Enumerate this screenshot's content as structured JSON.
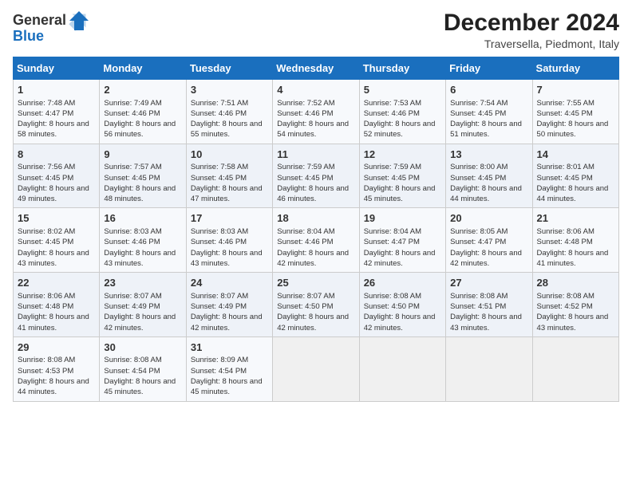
{
  "logo": {
    "line1": "General",
    "line2": "Blue"
  },
  "header": {
    "month": "December 2024",
    "location": "Traversella, Piedmont, Italy"
  },
  "weekdays": [
    "Sunday",
    "Monday",
    "Tuesday",
    "Wednesday",
    "Thursday",
    "Friday",
    "Saturday"
  ],
  "weeks": [
    [
      {
        "day": "1",
        "sunrise": "Sunrise: 7:48 AM",
        "sunset": "Sunset: 4:47 PM",
        "daylight": "Daylight: 8 hours and 58 minutes."
      },
      {
        "day": "2",
        "sunrise": "Sunrise: 7:49 AM",
        "sunset": "Sunset: 4:46 PM",
        "daylight": "Daylight: 8 hours and 56 minutes."
      },
      {
        "day": "3",
        "sunrise": "Sunrise: 7:51 AM",
        "sunset": "Sunset: 4:46 PM",
        "daylight": "Daylight: 8 hours and 55 minutes."
      },
      {
        "day": "4",
        "sunrise": "Sunrise: 7:52 AM",
        "sunset": "Sunset: 4:46 PM",
        "daylight": "Daylight: 8 hours and 54 minutes."
      },
      {
        "day": "5",
        "sunrise": "Sunrise: 7:53 AM",
        "sunset": "Sunset: 4:46 PM",
        "daylight": "Daylight: 8 hours and 52 minutes."
      },
      {
        "day": "6",
        "sunrise": "Sunrise: 7:54 AM",
        "sunset": "Sunset: 4:45 PM",
        "daylight": "Daylight: 8 hours and 51 minutes."
      },
      {
        "day": "7",
        "sunrise": "Sunrise: 7:55 AM",
        "sunset": "Sunset: 4:45 PM",
        "daylight": "Daylight: 8 hours and 50 minutes."
      }
    ],
    [
      {
        "day": "8",
        "sunrise": "Sunrise: 7:56 AM",
        "sunset": "Sunset: 4:45 PM",
        "daylight": "Daylight: 8 hours and 49 minutes."
      },
      {
        "day": "9",
        "sunrise": "Sunrise: 7:57 AM",
        "sunset": "Sunset: 4:45 PM",
        "daylight": "Daylight: 8 hours and 48 minutes."
      },
      {
        "day": "10",
        "sunrise": "Sunrise: 7:58 AM",
        "sunset": "Sunset: 4:45 PM",
        "daylight": "Daylight: 8 hours and 47 minutes."
      },
      {
        "day": "11",
        "sunrise": "Sunrise: 7:59 AM",
        "sunset": "Sunset: 4:45 PM",
        "daylight": "Daylight: 8 hours and 46 minutes."
      },
      {
        "day": "12",
        "sunrise": "Sunrise: 7:59 AM",
        "sunset": "Sunset: 4:45 PM",
        "daylight": "Daylight: 8 hours and 45 minutes."
      },
      {
        "day": "13",
        "sunrise": "Sunrise: 8:00 AM",
        "sunset": "Sunset: 4:45 PM",
        "daylight": "Daylight: 8 hours and 44 minutes."
      },
      {
        "day": "14",
        "sunrise": "Sunrise: 8:01 AM",
        "sunset": "Sunset: 4:45 PM",
        "daylight": "Daylight: 8 hours and 44 minutes."
      }
    ],
    [
      {
        "day": "15",
        "sunrise": "Sunrise: 8:02 AM",
        "sunset": "Sunset: 4:45 PM",
        "daylight": "Daylight: 8 hours and 43 minutes."
      },
      {
        "day": "16",
        "sunrise": "Sunrise: 8:03 AM",
        "sunset": "Sunset: 4:46 PM",
        "daylight": "Daylight: 8 hours and 43 minutes."
      },
      {
        "day": "17",
        "sunrise": "Sunrise: 8:03 AM",
        "sunset": "Sunset: 4:46 PM",
        "daylight": "Daylight: 8 hours and 43 minutes."
      },
      {
        "day": "18",
        "sunrise": "Sunrise: 8:04 AM",
        "sunset": "Sunset: 4:46 PM",
        "daylight": "Daylight: 8 hours and 42 minutes."
      },
      {
        "day": "19",
        "sunrise": "Sunrise: 8:04 AM",
        "sunset": "Sunset: 4:47 PM",
        "daylight": "Daylight: 8 hours and 42 minutes."
      },
      {
        "day": "20",
        "sunrise": "Sunrise: 8:05 AM",
        "sunset": "Sunset: 4:47 PM",
        "daylight": "Daylight: 8 hours and 42 minutes."
      },
      {
        "day": "21",
        "sunrise": "Sunrise: 8:06 AM",
        "sunset": "Sunset: 4:48 PM",
        "daylight": "Daylight: 8 hours and 41 minutes."
      }
    ],
    [
      {
        "day": "22",
        "sunrise": "Sunrise: 8:06 AM",
        "sunset": "Sunset: 4:48 PM",
        "daylight": "Daylight: 8 hours and 41 minutes."
      },
      {
        "day": "23",
        "sunrise": "Sunrise: 8:07 AM",
        "sunset": "Sunset: 4:49 PM",
        "daylight": "Daylight: 8 hours and 42 minutes."
      },
      {
        "day": "24",
        "sunrise": "Sunrise: 8:07 AM",
        "sunset": "Sunset: 4:49 PM",
        "daylight": "Daylight: 8 hours and 42 minutes."
      },
      {
        "day": "25",
        "sunrise": "Sunrise: 8:07 AM",
        "sunset": "Sunset: 4:50 PM",
        "daylight": "Daylight: 8 hours and 42 minutes."
      },
      {
        "day": "26",
        "sunrise": "Sunrise: 8:08 AM",
        "sunset": "Sunset: 4:50 PM",
        "daylight": "Daylight: 8 hours and 42 minutes."
      },
      {
        "day": "27",
        "sunrise": "Sunrise: 8:08 AM",
        "sunset": "Sunset: 4:51 PM",
        "daylight": "Daylight: 8 hours and 43 minutes."
      },
      {
        "day": "28",
        "sunrise": "Sunrise: 8:08 AM",
        "sunset": "Sunset: 4:52 PM",
        "daylight": "Daylight: 8 hours and 43 minutes."
      }
    ],
    [
      {
        "day": "29",
        "sunrise": "Sunrise: 8:08 AM",
        "sunset": "Sunset: 4:53 PM",
        "daylight": "Daylight: 8 hours and 44 minutes."
      },
      {
        "day": "30",
        "sunrise": "Sunrise: 8:08 AM",
        "sunset": "Sunset: 4:54 PM",
        "daylight": "Daylight: 8 hours and 45 minutes."
      },
      {
        "day": "31",
        "sunrise": "Sunrise: 8:09 AM",
        "sunset": "Sunset: 4:54 PM",
        "daylight": "Daylight: 8 hours and 45 minutes."
      },
      null,
      null,
      null,
      null
    ]
  ]
}
